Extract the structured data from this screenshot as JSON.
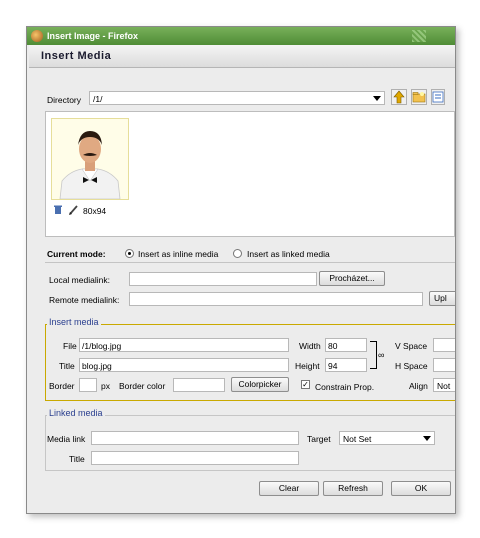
{
  "window": {
    "title": "Insert Image - Firefox"
  },
  "header": {
    "title": "Insert Media"
  },
  "directory": {
    "label": "Directory",
    "value": "/1/"
  },
  "thumbnail": {
    "size": "80x94"
  },
  "mode": {
    "label": "Current mode:",
    "inline": "Insert as inline media",
    "linked": "Insert as linked media",
    "selected": "inline"
  },
  "local_link": {
    "label": "Local medialink:",
    "browse": "Procházet..."
  },
  "remote_link": {
    "label": "Remote medialink:",
    "upload": "Upl"
  },
  "insert": {
    "legend": "Insert media",
    "file_label": "File",
    "file_value": "/1/blog.jpg",
    "title_label": "Title",
    "title_value": "blog.jpg",
    "width_label": "Width",
    "width_value": "80",
    "height_label": "Height",
    "height_value": "94",
    "vspace_label": "V Space",
    "hspace_label": "H Space",
    "border_label": "Border",
    "px": "px",
    "border_color_label": "Border color",
    "colorpicker": "Colorpicker",
    "constrain_label": "Constrain Prop.",
    "align_label": "Align",
    "align_value": "Not"
  },
  "linked": {
    "legend": "Linked media",
    "media_link_label": "Media link",
    "target_label": "Target",
    "target_value": "Not Set",
    "title_label": "Title"
  },
  "footer": {
    "clear": "Clear",
    "refresh": "Refresh",
    "ok": "OK"
  }
}
